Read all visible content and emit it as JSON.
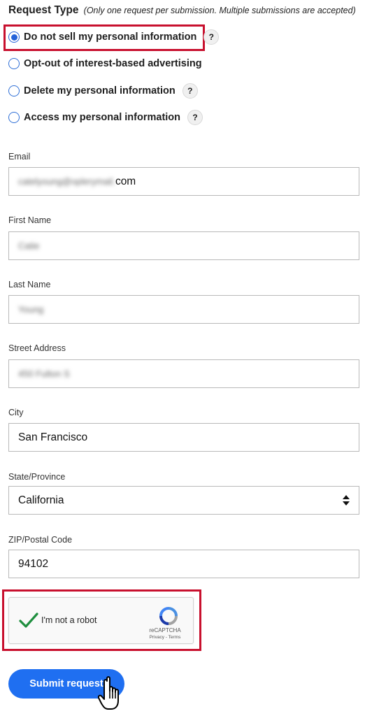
{
  "request_type": {
    "title": "Request Type",
    "note": "(Only one request per submission. Multiple submissions are accepted)",
    "options": [
      {
        "label": "Do not sell my personal information",
        "checked": true,
        "help": "?"
      },
      {
        "label": "Opt-out of interest-based advertising",
        "checked": false
      },
      {
        "label": "Delete my personal information",
        "checked": false,
        "help": "?"
      },
      {
        "label": "Access my personal information",
        "checked": false,
        "help": "?"
      }
    ]
  },
  "form": {
    "email_label": "Email",
    "email_value_blurred": "catelyoung@oplerymail.",
    "email_value_visible": "com",
    "first_name_label": "First Name",
    "first_name_value": "Catie",
    "last_name_label": "Last Name",
    "last_name_value": "Young",
    "street_label": "Street Address",
    "street_value": "450 Fulton S",
    "city_label": "City",
    "city_value": "San Francisco",
    "state_label": "State/Province",
    "state_value": "California",
    "zip_label": "ZIP/Postal Code",
    "zip_value": "94102"
  },
  "captcha": {
    "label": "I'm not a robot",
    "brand": "reCAPTCHA",
    "links": "Privacy - Terms"
  },
  "submit_label": "Submit request",
  "colors": {
    "accent": "#1f6ff1",
    "highlight": "#c8102e",
    "check": "#1e8e3e"
  }
}
